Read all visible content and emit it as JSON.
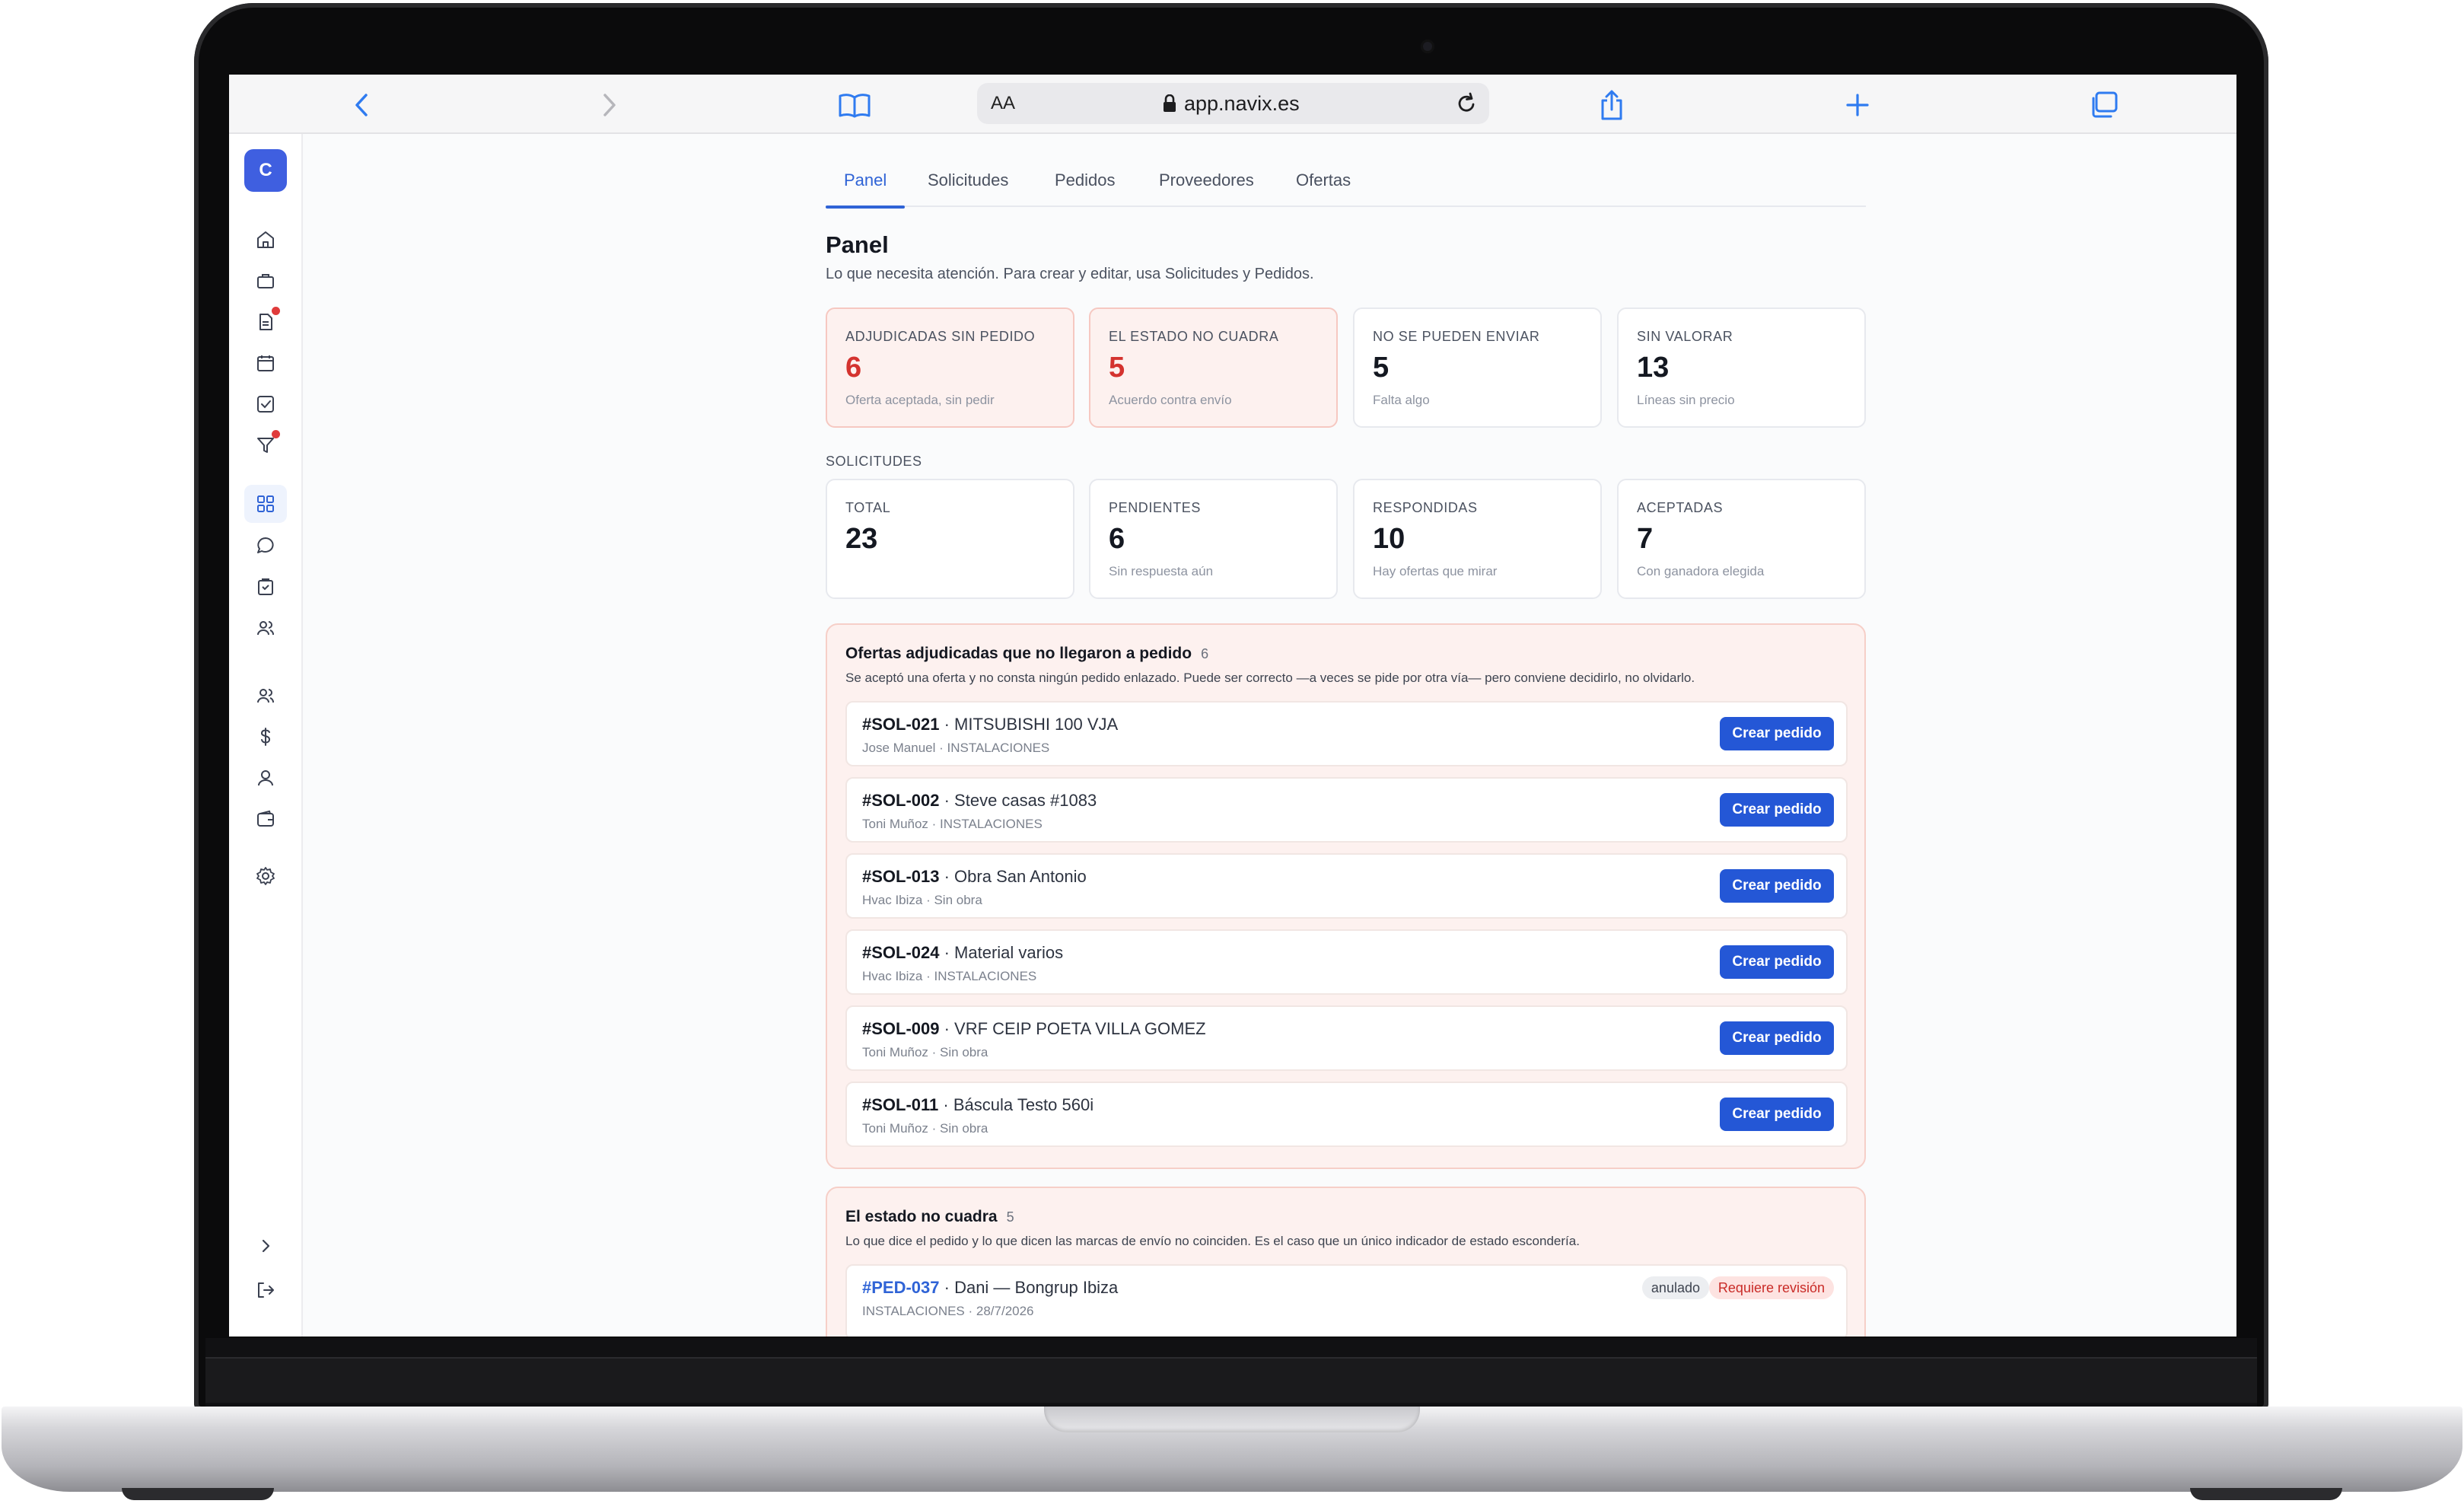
{
  "browser": {
    "aa_label": "AA",
    "url": "app.navix.es"
  },
  "sidebar": {
    "workspace_initial": "C",
    "items": [
      {
        "icon": "home-icon"
      },
      {
        "icon": "briefcase-icon"
      },
      {
        "icon": "document-icon",
        "notification": true
      },
      {
        "icon": "calendar-icon"
      },
      {
        "icon": "checklist-icon"
      },
      {
        "icon": "filter-icon",
        "notification": true
      },
      {
        "icon": "dashboard-grid-icon",
        "active": true
      },
      {
        "icon": "chat-icon"
      },
      {
        "icon": "clipboard-icon"
      },
      {
        "icon": "users-icon"
      },
      {
        "icon": "team-icon"
      },
      {
        "icon": "dollar-icon"
      },
      {
        "icon": "user-icon"
      },
      {
        "icon": "wallet-icon"
      },
      {
        "icon": "settings-icon"
      },
      {
        "icon": "chevron-right-icon"
      },
      {
        "icon": "logout-icon"
      }
    ]
  },
  "tabs": [
    {
      "label": "Panel",
      "active": true
    },
    {
      "label": "Solicitudes"
    },
    {
      "label": "Pedidos"
    },
    {
      "label": "Proveedores"
    },
    {
      "label": "Ofertas"
    }
  ],
  "page": {
    "title": "Panel",
    "subtitle": "Lo que necesita atención. Para crear y editar, usa Solicitudes y Pedidos."
  },
  "alert_cards": [
    {
      "label": "ADJUDICADAS SIN PEDIDO",
      "value": "6",
      "hint": "Oferta aceptada, sin pedir",
      "alert": true
    },
    {
      "label": "EL ESTADO NO CUADRA",
      "value": "5",
      "hint": "Acuerdo contra envío",
      "alert": true
    },
    {
      "label": "NO SE PUEDEN ENVIAR",
      "value": "5",
      "hint": "Falta algo"
    },
    {
      "label": "SIN VALORAR",
      "value": "13",
      "hint": "Líneas sin precio"
    }
  ],
  "solicitudes": {
    "section_label": "SOLICITUDES",
    "cards": [
      {
        "label": "TOTAL",
        "value": "23",
        "hint": ""
      },
      {
        "label": "PENDIENTES",
        "value": "6",
        "hint": "Sin respuesta aún"
      },
      {
        "label": "RESPONDIDAS",
        "value": "10",
        "hint": "Hay ofertas que mirar"
      },
      {
        "label": "ACEPTADAS",
        "value": "7",
        "hint": "Con ganadora elegida"
      }
    ]
  },
  "adjudicadas_panel": {
    "title": "Ofertas adjudicadas que no llegaron a pedido",
    "count": "6",
    "description": "Se aceptó una oferta y no consta ningún pedido enlazado. Puede ser correcto —a veces se pide por otra vía— pero conviene decidirlo, no olvidarlo.",
    "button_label": "Crear pedido",
    "rows": [
      {
        "code": "#SOL-021",
        "name": " · MITSUBISHI 100 VJA",
        "sub": "Jose Manuel · INSTALACIONES"
      },
      {
        "code": "#SOL-002",
        "name": " · Steve casas #1083",
        "sub": "Toni Muñoz · INSTALACIONES"
      },
      {
        "code": "#SOL-013",
        "name": " · Obra San Antonio",
        "sub": "Hvac Ibiza · Sin obra"
      },
      {
        "code": "#SOL-024",
        "name": " · Material varios",
        "sub": "Hvac Ibiza · INSTALACIONES"
      },
      {
        "code": "#SOL-009",
        "name": " · VRF CEIP POETA VILLA GOMEZ",
        "sub": "Toni Muñoz · Sin obra"
      },
      {
        "code": "#SOL-011",
        "name": " · Báscula Testo 560i",
        "sub": "Toni Muñoz · Sin obra"
      }
    ]
  },
  "estado_panel": {
    "title": "El estado no cuadra",
    "count": "5",
    "description": "Lo que dice el pedido y lo que dicen las marcas de envío no coinciden. Es el caso que un único indicador de estado escondería.",
    "rows": [
      {
        "code": "#PED-037",
        "name": " · Dani — Bongrup Ibiza",
        "sub": "INSTALACIONES · 28/7/2026",
        "badge_status": "anulado",
        "badge_review": "Requiere revisión"
      }
    ]
  },
  "colors": {
    "accent": "#2f63d6",
    "button": "#2457d6",
    "alert_text": "#d4332f",
    "alert_bg": "#fdf1ef"
  }
}
